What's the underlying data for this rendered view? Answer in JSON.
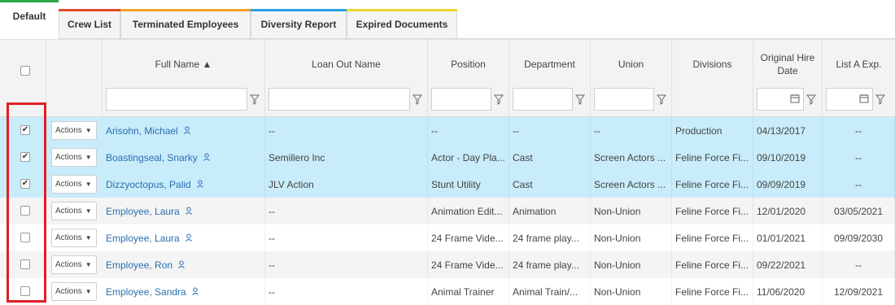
{
  "tabs": [
    {
      "label": "Default",
      "color": "#2aa84a",
      "active": true
    },
    {
      "label": "Crew List",
      "color": "#e54a2a",
      "active": false
    },
    {
      "label": "Terminated Employees",
      "color": "#f2a12a",
      "active": false
    },
    {
      "label": "Diversity Report",
      "color": "#2aa1e5",
      "active": false
    },
    {
      "label": "Expired Documents",
      "color": "#f2d62a",
      "active": false
    }
  ],
  "columns": {
    "full_name": "Full Name ▲",
    "loan_out": "Loan Out Name",
    "position": "Position",
    "department": "Department",
    "union": "Union",
    "divisions": "Divisions",
    "hire_date": "Original Hire Date",
    "list_a": "List A Exp."
  },
  "actions_label": "Actions",
  "icons": {
    "filter": "filter-icon",
    "calendar": "calendar-icon",
    "person": "person-icon",
    "caret": "caret-down-icon"
  },
  "colors": {
    "selected_row": "#c8ecfa",
    "link": "#2a6fb0",
    "highlight_box": "#e01e25"
  },
  "rows": [
    {
      "checked": true,
      "name": "Arisohn, Michael",
      "loan_out": "--",
      "position": "--",
      "department": "--",
      "union": "--",
      "divisions": "Production",
      "hire": "04/13/2017",
      "list_a": "--"
    },
    {
      "checked": true,
      "name": "Boastingseal, Snarky",
      "loan_out": "Semillero Inc",
      "position": "Actor - Day Pla...",
      "department": "Cast",
      "union": "Screen Actors ...",
      "divisions": "Feline Force Fi...",
      "hire": "09/10/2019",
      "list_a": "--"
    },
    {
      "checked": true,
      "name": "Dizzyoctopus, Palid",
      "loan_out": "JLV Action",
      "position": "Stunt Utility",
      "department": "Cast",
      "union": "Screen Actors ...",
      "divisions": "Feline Force Fi...",
      "hire": "09/09/2019",
      "list_a": "--"
    },
    {
      "checked": false,
      "name": "Employee, Laura",
      "loan_out": "--",
      "position": "Animation Edit...",
      "department": "Animation",
      "union": "Non-Union",
      "divisions": "Feline Force Fi...",
      "hire": "12/01/2020",
      "list_a": "03/05/2021"
    },
    {
      "checked": false,
      "name": "Employee, Laura",
      "loan_out": "--",
      "position": "24 Frame Vide...",
      "department": "24 frame play...",
      "union": "Non-Union",
      "divisions": "Feline Force Fi...",
      "hire": "01/01/2021",
      "list_a": "09/09/2030"
    },
    {
      "checked": false,
      "name": "Employee, Ron",
      "loan_out": "--",
      "position": "24 Frame Vide...",
      "department": "24 frame play...",
      "union": "Non-Union",
      "divisions": "Feline Force Fi...",
      "hire": "09/22/2021",
      "list_a": "--"
    },
    {
      "checked": false,
      "name": "Employee, Sandra",
      "loan_out": "--",
      "position": "Animal Trainer",
      "department": "Animal Train/...",
      "union": "Non-Union",
      "divisions": "Feline Force Fi...",
      "hire": "11/06/2020",
      "list_a": "12/09/2021"
    }
  ]
}
